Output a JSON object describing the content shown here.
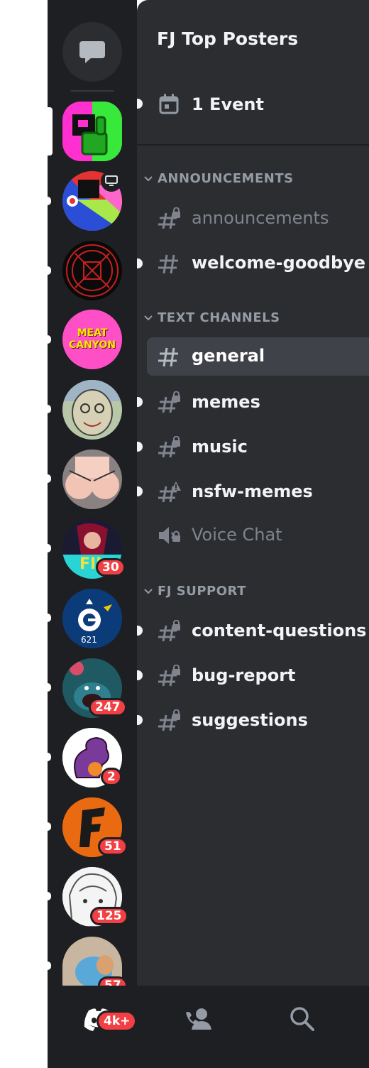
{
  "guild": {
    "name": "FJ Top Posters",
    "event_label": "1 Event"
  },
  "categories": [
    {
      "label": "ANNOUNCEMENTS"
    },
    {
      "label": "TEXT CHANNELS"
    },
    {
      "label": "FJ SUPPORT"
    }
  ],
  "channels": {
    "announcements": "announcements",
    "welcome_goodbye": "welcome-goodbye",
    "general": "general",
    "memes": "memes",
    "music": "music",
    "nsfw_memes": "nsfw-memes",
    "voice_chat": "Voice Chat",
    "content_questions": "content-questions",
    "bug_report": "bug-report",
    "suggestions": "suggestions"
  },
  "servers": {
    "meat_canyon_text": "MEAT CANYON",
    "fil_badge": "30",
    "shark_badge": "247",
    "dino_badge": "2",
    "f_badge": "51",
    "anime_badge": "125",
    "last_badge": "57"
  },
  "nav": {
    "home_badge": "4k+"
  },
  "colors": {
    "rail_bg": "#1e1f22",
    "sidebar_bg": "#2b2d31",
    "active_channel_bg": "#404249",
    "badge_red": "#f23f43",
    "muted_text": "#949ba4"
  }
}
